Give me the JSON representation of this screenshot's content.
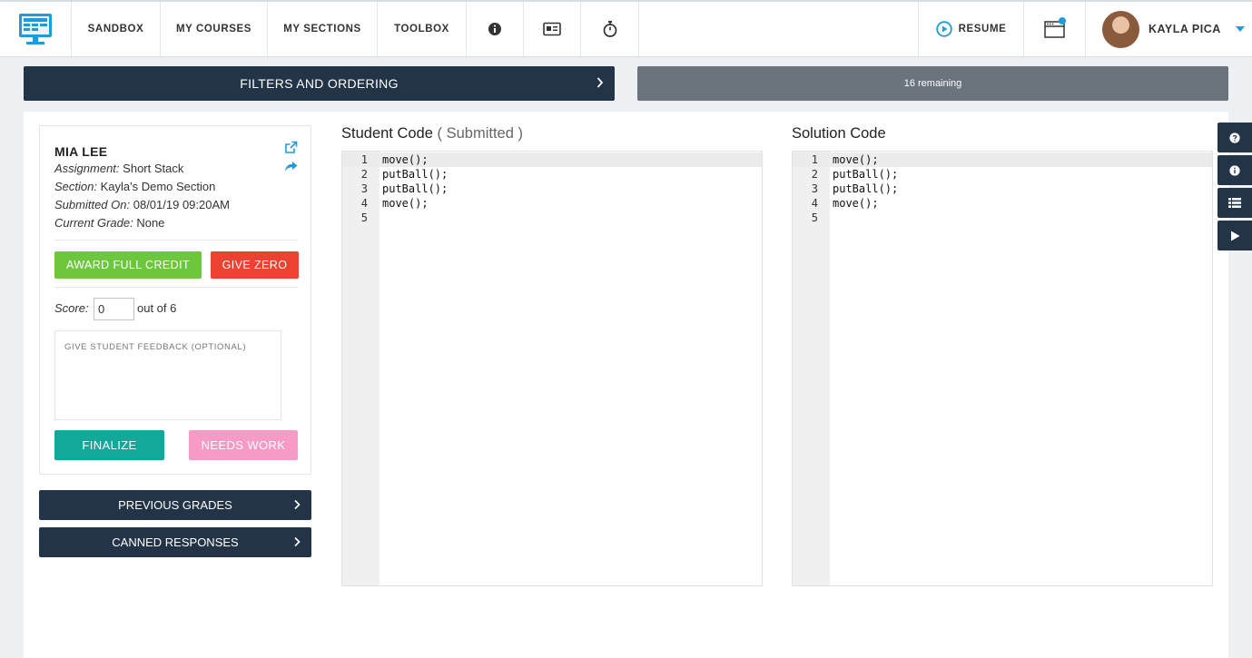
{
  "nav": {
    "items": [
      "SANDBOX",
      "MY COURSES",
      "MY SECTIONS",
      "TOOLBOX"
    ],
    "resume_label": "RESUME",
    "user_name": "KAYLA PICA"
  },
  "filters": {
    "label": "FILTERS AND ORDERING",
    "remaining": "16 remaining"
  },
  "student": {
    "name": "MIA LEE",
    "assignment_label": "Assignment:",
    "assignment": "Short Stack",
    "section_label": "Section:",
    "section": "Kayla's Demo Section",
    "submitted_label": "Submitted On:",
    "submitted": "08/01/19 09:20AM",
    "grade_label": "Current Grade:",
    "grade": "None"
  },
  "grading": {
    "award_full_credit": "AWARD FULL CREDIT",
    "give_zero": "GIVE ZERO",
    "score_label": "Score:",
    "score_value": "0",
    "out_of": "out of 6",
    "feedback_placeholder": "GIVE STUDENT FEEDBACK (OPTIONAL)",
    "finalize": "FINALIZE",
    "needs_work": "NEEDS WORK"
  },
  "panels": {
    "previous_grades": "PREVIOUS GRADES",
    "canned_responses": "CANNED RESPONSES"
  },
  "student_code": {
    "title": "Student Code",
    "status": "( Submitted )",
    "line_numbers": [
      "1",
      "2",
      "3",
      "4",
      "5"
    ],
    "lines": [
      "move();",
      "putBall();",
      "putBall();",
      "move();",
      ""
    ]
  },
  "solution_code": {
    "title": "Solution Code",
    "line_numbers": [
      "1",
      "2",
      "3",
      "4",
      "5"
    ],
    "lines": [
      "move();",
      "putBall();",
      "putBall();",
      "move();",
      ""
    ]
  },
  "colors": {
    "navy": "#233348",
    "green": "#6dc63e",
    "red": "#ed4131",
    "teal": "#12a99a",
    "pink": "#f79ac6",
    "accent_blue": "#1e9bd8"
  },
  "icons": [
    "monitor-logo-icon",
    "info-icon",
    "id-card-icon",
    "stopwatch-icon",
    "play-circle-icon",
    "browser-window-icon",
    "caret-down-icon",
    "external-link-icon",
    "share-arrow-icon",
    "chevron-right-icon",
    "question-icon",
    "list-icon",
    "play-icon"
  ]
}
